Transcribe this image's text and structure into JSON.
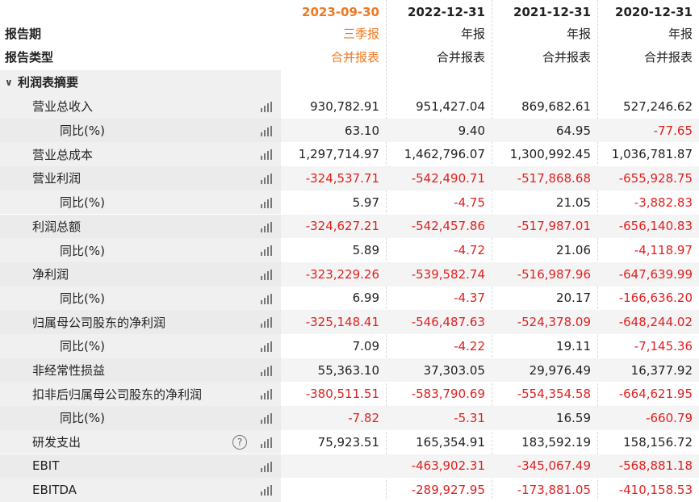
{
  "header": {
    "dates": [
      "2023-09-30",
      "2022-12-31",
      "2021-12-31",
      "2020-12-31"
    ],
    "period_label": "报告期",
    "periods": [
      "三季报",
      "年报",
      "年报",
      "年报"
    ],
    "type_label": "报告类型",
    "types": [
      "合并报表",
      "合并报表",
      "合并报表",
      "合并报表"
    ]
  },
  "section": {
    "label": "利润表摘要",
    "chevron_icon": "chevron-down-icon"
  },
  "colors": {
    "highlight": "#f07820",
    "negative": "#e02020",
    "row_alt": "#f4f4f4"
  },
  "rows": [
    {
      "label": "营业总收入",
      "level": 1,
      "values": [
        "930,782.91",
        "951,427.04",
        "869,682.61",
        "527,246.62"
      ]
    },
    {
      "label": "同比(%)",
      "level": 2,
      "values": [
        "63.10",
        "9.40",
        "64.95",
        "-77.65"
      ]
    },
    {
      "label": "营业总成本",
      "level": 1,
      "values": [
        "1,297,714.97",
        "1,462,796.07",
        "1,300,992.45",
        "1,036,781.87"
      ]
    },
    {
      "label": "营业利润",
      "level": 1,
      "values": [
        "-324,537.71",
        "-542,490.71",
        "-517,868.68",
        "-655,928.75"
      ]
    },
    {
      "label": "同比(%)",
      "level": 2,
      "values": [
        "5.97",
        "-4.75",
        "21.05",
        "-3,882.83"
      ]
    },
    {
      "label": "利润总额",
      "level": 1,
      "values": [
        "-324,627.21",
        "-542,457.86",
        "-517,987.01",
        "-656,140.83"
      ]
    },
    {
      "label": "同比(%)",
      "level": 2,
      "values": [
        "5.89",
        "-4.72",
        "21.06",
        "-4,118.97"
      ]
    },
    {
      "label": "净利润",
      "level": 1,
      "values": [
        "-323,229.26",
        "-539,582.74",
        "-516,987.96",
        "-647,639.99"
      ]
    },
    {
      "label": "同比(%)",
      "level": 2,
      "values": [
        "6.99",
        "-4.37",
        "20.17",
        "-166,636.20"
      ]
    },
    {
      "label": "归属母公司股东的净利润",
      "level": 1,
      "values": [
        "-325,148.41",
        "-546,487.63",
        "-524,378.09",
        "-648,244.02"
      ]
    },
    {
      "label": "同比(%)",
      "level": 2,
      "values": [
        "7.09",
        "-4.22",
        "19.11",
        "-7,145.36"
      ]
    },
    {
      "label": "非经常性损益",
      "level": 1,
      "values": [
        "55,363.10",
        "37,303.05",
        "29,976.49",
        "16,377.92"
      ]
    },
    {
      "label": "扣非后归属母公司股东的净利润",
      "level": 1,
      "values": [
        "-380,511.51",
        "-583,790.69",
        "-554,354.58",
        "-664,621.95"
      ]
    },
    {
      "label": "同比(%)",
      "level": 2,
      "values": [
        "-7.82",
        "-5.31",
        "16.59",
        "-660.79"
      ]
    },
    {
      "label": "研发支出",
      "level": 1,
      "values": [
        "75,923.51",
        "165,354.91",
        "183,592.19",
        "158,156.72"
      ],
      "help": "?"
    },
    {
      "label": "EBIT",
      "level": 1,
      "values": [
        "",
        "-463,902.31",
        "-345,067.49",
        "-568,881.18"
      ]
    },
    {
      "label": "EBITDA",
      "level": 1,
      "values": [
        "",
        "-289,927.95",
        "-173,881.05",
        "-410,158.53"
      ]
    }
  ]
}
